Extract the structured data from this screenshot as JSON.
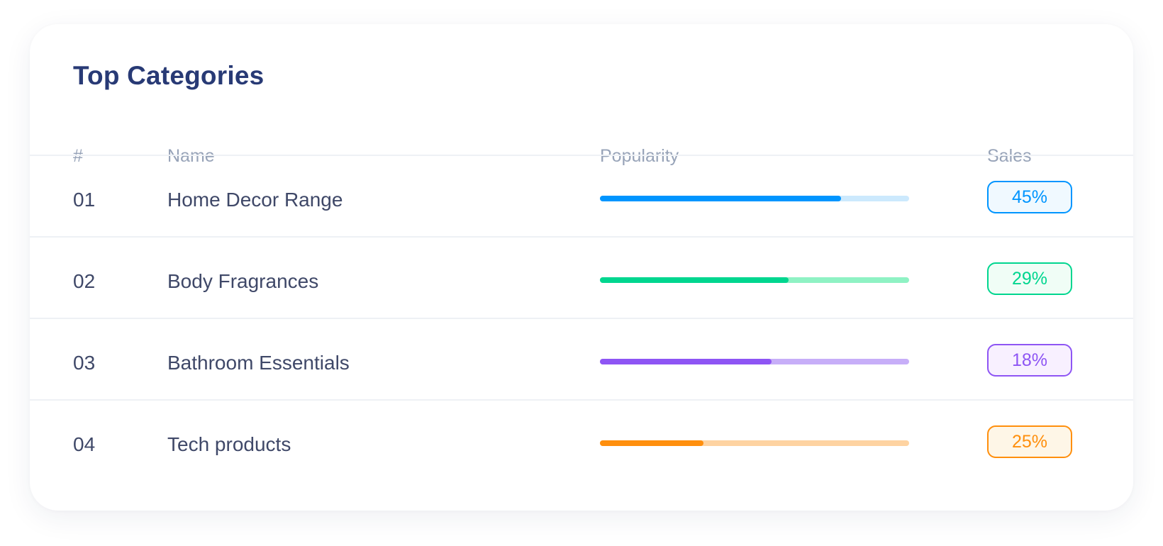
{
  "card": {
    "title": "Top Categories",
    "columns": {
      "index": "#",
      "name": "Name",
      "popularity": "Popularity",
      "sales": "Sales"
    },
    "rows": [
      {
        "index": "01",
        "name": "Home Decor Range",
        "popularity": 0.78,
        "sales": "45%",
        "color": "#0095ff",
        "track_color": "#cce9fd",
        "badge_bg": "#f0f9ff"
      },
      {
        "index": "02",
        "name": "Body Fragrances",
        "popularity": 0.61,
        "sales": "29%",
        "color": "#00d68f",
        "track_color": "#8ff2c4",
        "badge_bg": "#f0fdf6"
      },
      {
        "index": "03",
        "name": "Bathroom Essentials",
        "popularity": 0.555,
        "sales": "18%",
        "color": "#8e55f4",
        "track_color": "#c7aef8",
        "badge_bg": "#f8f0ff"
      },
      {
        "index": "04",
        "name": "Tech products",
        "popularity": 0.335,
        "sales": "25%",
        "color": "#ff8f0d",
        "track_color": "#fed3a1",
        "badge_bg": "#fef6e7"
      }
    ]
  }
}
